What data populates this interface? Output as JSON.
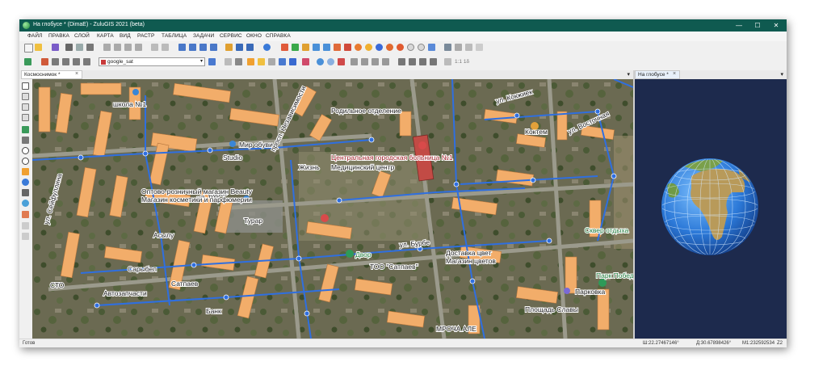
{
  "window": {
    "title": "На глобусе * (DimaE) - ZuluGIS 2021 (beta)"
  },
  "menu": [
    "ФАЙЛ",
    "ПРАВКА",
    "СЛОЙ",
    "КАРТА",
    "ВИД",
    "РАСТР",
    "ТАБЛИЦА",
    "ЗАДАЧИ",
    "СЕРВИС",
    "ОКНО",
    "СПРАВКА"
  ],
  "toolbar": {
    "layer_combo_value": "google_sat",
    "scale_label": "1:1 1δ"
  },
  "tabs": {
    "map_tab": "Космоснимок *",
    "globe_tab": "На глобусе *"
  },
  "map_labels": {
    "school": "школа №1",
    "hospital_dept": "Родильное отделение",
    "hospital": "Центральная городская больница №1",
    "hospital_sub": "Медицинский центр",
    "shoes": "Мир обуви",
    "studio": "Studio",
    "street_nezav": "просп. Независимости",
    "living": "Жизнь",
    "ul_burbe_1": "ул. Бурбе",
    "ul_burbe_2": "ул. Бурбе",
    "store": "Оптово-розничный магазин Beauty",
    "store_sub": "Магазин косметики и парфюмерии",
    "turar": "Турар",
    "asylu": "Асылу",
    "sarybel": "Сарыбел",
    "seyfullin": "ул. Сейфуллина",
    "sto": "СТО",
    "avto": "Автозапчасти",
    "satpaev": "Сатпаев",
    "bank": "Банк",
    "dvor": "Двор",
    "dostavka": "Доставка цвет",
    "dostavka_sub": "Магазин цветов",
    "too": "ТОО \"Сатпаев\"",
    "kokten": "Коктем",
    "kokten_street": "ул. Кокжиек",
    "vostok": "ул. Восточная",
    "skver": "Сквер отдыха",
    "park": "Парк Победы",
    "parkovka": "Парковка",
    "square": "Площадь Славы",
    "mrochanale": "МРОЧА АЛЕ"
  },
  "status": {
    "ready": "Готов",
    "lat": "Ш:22.27467146°",
    "lon": "Д:30.67898426°",
    "scale": "М1:232592534",
    "zoom": "Z2"
  },
  "colors": {
    "titlebar": "#0f5a50",
    "pipes": "#2f6fe0",
    "buildings": "#f2ad6a",
    "globe_bg": "#1d2a4d"
  }
}
